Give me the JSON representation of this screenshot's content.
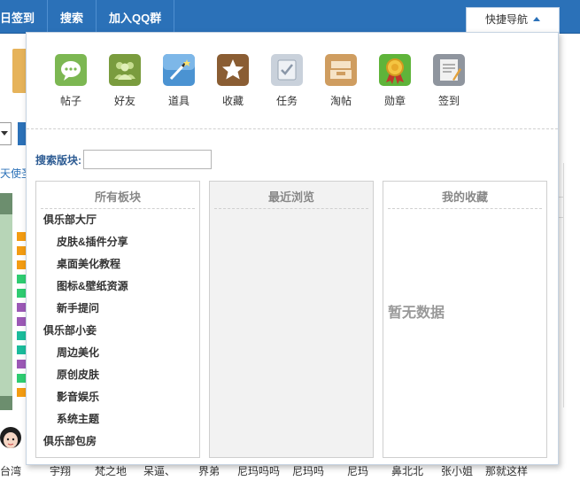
{
  "topnav": {
    "items": [
      "日签到",
      "搜索",
      "加入QQ群"
    ],
    "quick_nav_label": "快捷导航"
  },
  "background": {
    "partial_link": "天使圣",
    "bottom_names": [
      "台湾",
      "宇翔",
      "梵之地",
      "呆逼、",
      "界弟",
      "尼玛吗吗",
      "尼玛吗",
      "尼玛",
      "鼻北北",
      "张小姐",
      "那就这样"
    ]
  },
  "quick_nav": {
    "icons": [
      {
        "label": "帖子",
        "icon": "speech-bubble-icon",
        "color": "#6aa84f"
      },
      {
        "label": "好友",
        "icon": "friends-icon",
        "color": "#7da044"
      },
      {
        "label": "道具",
        "icon": "magic-wand-icon",
        "color": "#3d86c6"
      },
      {
        "label": "收藏",
        "icon": "star-icon",
        "color": "#7e5a35"
      },
      {
        "label": "任务",
        "icon": "checklist-icon",
        "color": "#b9c3cf"
      },
      {
        "label": "淘帖",
        "icon": "tray-icon",
        "color": "#c7955a"
      },
      {
        "label": "勋章",
        "icon": "medal-icon",
        "color": "#6abf3a"
      },
      {
        "label": "签到",
        "icon": "sign-board-icon",
        "color": "#8a9099"
      }
    ],
    "search_label": "搜索版块:",
    "search_value": "",
    "panels": {
      "all_forums": {
        "title": "所有板块",
        "items": [
          {
            "label": "俱乐部大厅",
            "level": "group"
          },
          {
            "label": "皮肤&插件分享",
            "level": "sub"
          },
          {
            "label": "桌面美化教程",
            "level": "sub"
          },
          {
            "label": "图标&壁纸资源",
            "level": "sub"
          },
          {
            "label": "新手提问",
            "level": "sub"
          },
          {
            "label": "俱乐部小妾",
            "level": "group"
          },
          {
            "label": "周边美化",
            "level": "sub"
          },
          {
            "label": "原创皮肤",
            "level": "sub"
          },
          {
            "label": "影音娱乐",
            "level": "sub"
          },
          {
            "label": "系统主题",
            "level": "sub"
          },
          {
            "label": "俱乐部包房",
            "level": "group"
          }
        ]
      },
      "recent": {
        "title": "最近浏览"
      },
      "favorites": {
        "title": "我的收藏",
        "empty_text": "暂无数据"
      }
    }
  }
}
